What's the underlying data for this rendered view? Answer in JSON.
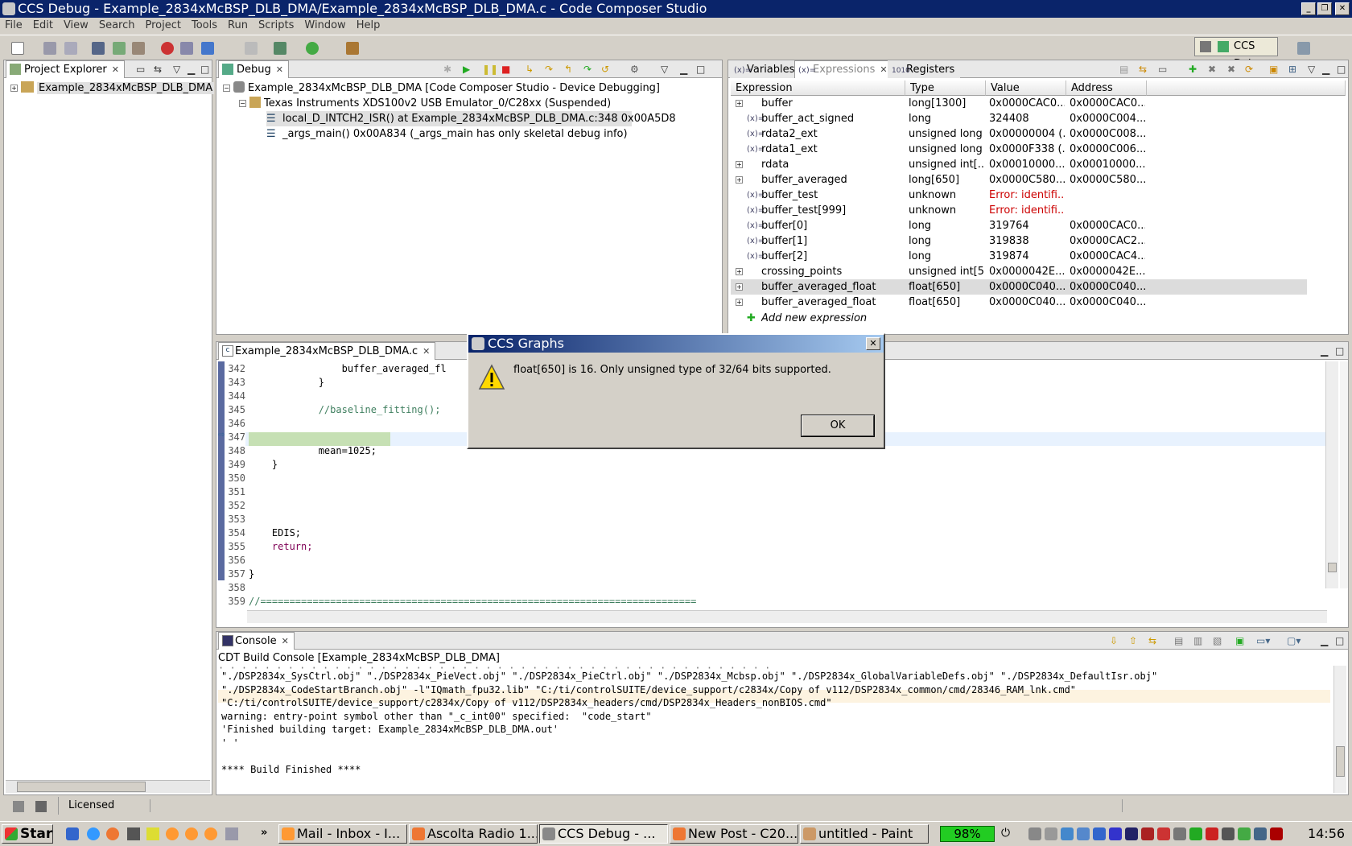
{
  "window": {
    "title": "CCS Debug - Example_2834xMcBSP_DLB_DMA/Example_2834xMcBSP_DLB_DMA.c - Code Composer Studio"
  },
  "menu": [
    "File",
    "Edit",
    "View",
    "Search",
    "Project",
    "Tools",
    "Run",
    "Scripts",
    "Window",
    "Help"
  ],
  "perspective": {
    "label": "CCS Debug"
  },
  "project_explorer": {
    "tab": "Project Explorer",
    "root": "Example_2834xMcBSP_DLB_DMA"
  },
  "debug": {
    "tab": "Debug",
    "items": [
      "Example_2834xMcBSP_DLB_DMA [Code Composer Studio - Device Debugging]",
      "Texas Instruments XDS100v2 USB Emulator_0/C28xx (Suspended)",
      "local_D_INTCH2_ISR() at Example_2834xMcBSP_DLB_DMA.c:348 0x00A5D8",
      "_args_main() 0x00A834  (_args_main has only skeletal debug info)"
    ]
  },
  "expressions": {
    "tabs": [
      "Variables",
      "Expressions",
      "Registers"
    ],
    "columns": [
      "Expression",
      "Type",
      "Value",
      "Address"
    ],
    "rows": [
      {
        "name": "buffer",
        "type": "long[1300]",
        "value": "0x0000CAC0...",
        "address": "0x0000CAC0..."
      },
      {
        "name": "buffer_act_signed",
        "type": "long",
        "value": "324408",
        "address": "0x0000C004..."
      },
      {
        "name": "rdata2_ext",
        "type": "unsigned long",
        "value": "0x00000004 (...",
        "address": "0x0000C008..."
      },
      {
        "name": "rdata1_ext",
        "type": "unsigned long",
        "value": "0x0000F338 (...",
        "address": "0x0000C006..."
      },
      {
        "name": "rdata",
        "type": "unsigned int[...",
        "value": "0x00010000...",
        "address": "0x00010000..."
      },
      {
        "name": "buffer_averaged",
        "type": "long[650]",
        "value": "0x0000C580...",
        "address": "0x0000C580..."
      },
      {
        "name": "buffer_test",
        "type": "unknown",
        "value": "Error: identifi...",
        "address": ""
      },
      {
        "name": "buffer_test[999]",
        "type": "unknown",
        "value": "Error: identifi...",
        "address": ""
      },
      {
        "name": "buffer[0]",
        "type": "long",
        "value": "319764",
        "address": "0x0000CAC0..."
      },
      {
        "name": "buffer[1]",
        "type": "long",
        "value": "319838",
        "address": "0x0000CAC2..."
      },
      {
        "name": "buffer[2]",
        "type": "long",
        "value": "319874",
        "address": "0x0000CAC4..."
      },
      {
        "name": "crossing_points",
        "type": "unsigned int[5]",
        "value": "0x0000042E...",
        "address": "0x0000042E..."
      },
      {
        "name": "buffer_averaged_float",
        "type": "float[650]",
        "value": "0x0000C040...",
        "address": "0x0000C040..."
      },
      {
        "name": "buffer_averaged_float",
        "type": "float[650]",
        "value": "0x0000C040...",
        "address": "0x0000C040..."
      }
    ],
    "add_new": "Add new expression"
  },
  "editor": {
    "tab": "Example_2834xMcBSP_DLB_DMA.c",
    "lines": [
      {
        "n": "342",
        "t": "                buffer_averaged_fl"
      },
      {
        "n": "343",
        "t": "            }"
      },
      {
        "n": "344",
        "t": ""
      },
      {
        "n": "345",
        "t": "            //baseline_fitting();"
      },
      {
        "n": "346",
        "t": ""
      },
      {
        "n": "347",
        "t": ""
      },
      {
        "n": "348",
        "t": "            mean=1025;"
      },
      {
        "n": "349",
        "t": "    }"
      },
      {
        "n": "350",
        "t": ""
      },
      {
        "n": "351",
        "t": ""
      },
      {
        "n": "352",
        "t": ""
      },
      {
        "n": "353",
        "t": ""
      },
      {
        "n": "354",
        "t": "    EDIS;"
      },
      {
        "n": "355",
        "t": "    return;"
      },
      {
        "n": "356",
        "t": ""
      },
      {
        "n": "357",
        "t": "}"
      },
      {
        "n": "358",
        "t": ""
      },
      {
        "n": "359",
        "t": "//==========================================================================="
      }
    ]
  },
  "dialog": {
    "title": "CCS Graphs",
    "message": "float[650] is 16. Only unsigned type of 32/64 bits supported.",
    "ok": "OK"
  },
  "console": {
    "tab": "Console",
    "subtitle": "CDT Build Console [Example_2834xMcBSP_DLB_DMA]",
    "lines": [
      "\"./DSP2834x_SysCtrl.obj\" \"./DSP2834x_PieVect.obj\" \"./DSP2834x_PieCtrl.obj\" \"./DSP2834x_Mcbsp.obj\" \"./DSP2834x_GlobalVariableDefs.obj\" \"./DSP2834x_DefaultIsr.obj\"",
      "\"./DSP2834x_CodeStartBranch.obj\" -l\"IQmath_fpu32.lib\" \"C:/ti/controlSUITE/device_support/c2834x/Copy of v112/DSP2834x_common/cmd/28346_RAM_lnk.cmd\"",
      "\"C:/ti/controlSUITE/device_support/c2834x/Copy of v112/DSP2834x_headers/cmd/DSP2834x_Headers_nonBIOS.cmd\"",
      "warning: entry-point symbol other than \"_c_int00\" specified:  \"code_start\"",
      "'Finished building target: Example_2834xMcBSP_DLB_DMA.out'",
      "' '",
      "",
      "**** Build Finished ****"
    ]
  },
  "statusbar": {
    "licensed": "Licensed"
  },
  "taskbar": {
    "start": "Start",
    "tasks": [
      "Mail - Inbox - I...",
      "Ascolta Radio 1...",
      "CCS Debug - ...",
      "New Post - C20...",
      "untitled - Paint"
    ],
    "battery": "98%",
    "clock": "14:56"
  }
}
